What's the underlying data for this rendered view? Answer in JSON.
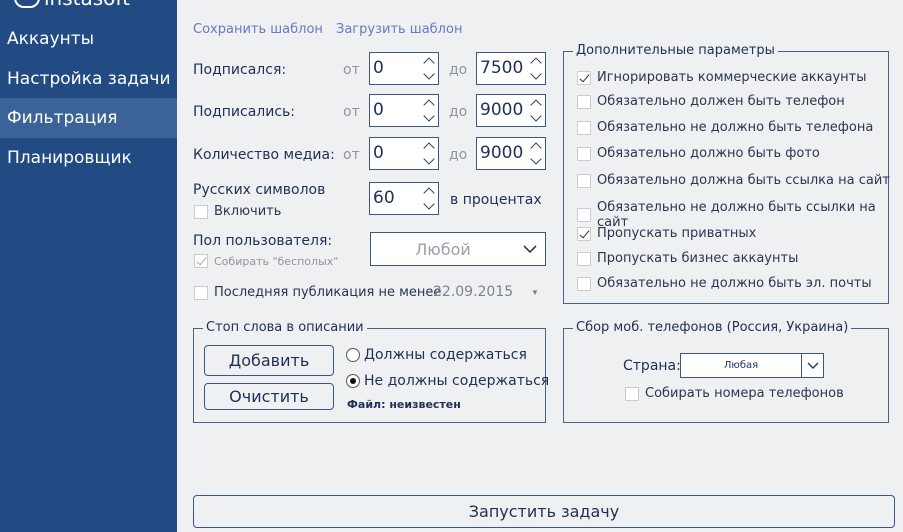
{
  "app": {
    "logo_text": "instasoft"
  },
  "sidebar": {
    "items": [
      {
        "label": "Аккаунты"
      },
      {
        "label": "Настройка задачи"
      },
      {
        "label": "Фильтрация"
      },
      {
        "label": "Планировщик"
      }
    ],
    "active_index": 2
  },
  "template_links": {
    "save": "Сохранить шаблон",
    "load": "Загрузить шаблон"
  },
  "ranges": {
    "from_label": "от",
    "to_label": "до",
    "rows": [
      {
        "label": "Подписался:",
        "from": "0",
        "to": "7500"
      },
      {
        "label": "Подписались:",
        "from": "0",
        "to": "9000"
      },
      {
        "label": "Количество медиа:",
        "from": "0",
        "to": "9000"
      }
    ]
  },
  "russian": {
    "label": "Русских символов",
    "value": "60",
    "suffix": "в процентах",
    "enable_label": "Включить",
    "enable_checked": false
  },
  "gender": {
    "label": "Пол пользователя:",
    "value": "Любой",
    "collect_label": "Собирать \"бесполых\"",
    "collect_checked": true
  },
  "last_post": {
    "label": "Последняя публикация не менее",
    "date": "22.09.2015",
    "checked": false
  },
  "extra": {
    "title": "Дополнительные параметры",
    "options": [
      {
        "label": "Игнорировать коммерческие аккаунты",
        "checked": true
      },
      {
        "label": "Обязательно должен быть телефон",
        "checked": false
      },
      {
        "label": "Обязательно не должно быть телефона",
        "checked": false
      },
      {
        "label": "Обязательно должно быть фото",
        "checked": false
      },
      {
        "label": "Обязательно должна быть ссылка на сайт",
        "checked": false
      },
      {
        "label": "Обязательно не должно быть ссылки на сайт",
        "checked": false
      },
      {
        "label": "Пропускать приватных",
        "checked": true
      },
      {
        "label": "Пропускать бизнес аккаунты",
        "checked": false
      },
      {
        "label": "Обязательно не должно быть эл. почты",
        "checked": false
      }
    ]
  },
  "stopwords": {
    "title": "Стоп слова в описании",
    "add": "Добавить",
    "clear": "Очистить",
    "radio_must": "Должны содержаться",
    "radio_must_not": "Не должны содержаться",
    "selected": "must_not",
    "file_status": "Файл: неизвестен"
  },
  "phones": {
    "title": "Сбор моб. телефонов (Россия, Украина)",
    "country_label": "Страна:",
    "country_value": "Любая",
    "collect_label": "Собирать номера телефонов",
    "collect_checked": false
  },
  "run_button": "Запустить задачу"
}
